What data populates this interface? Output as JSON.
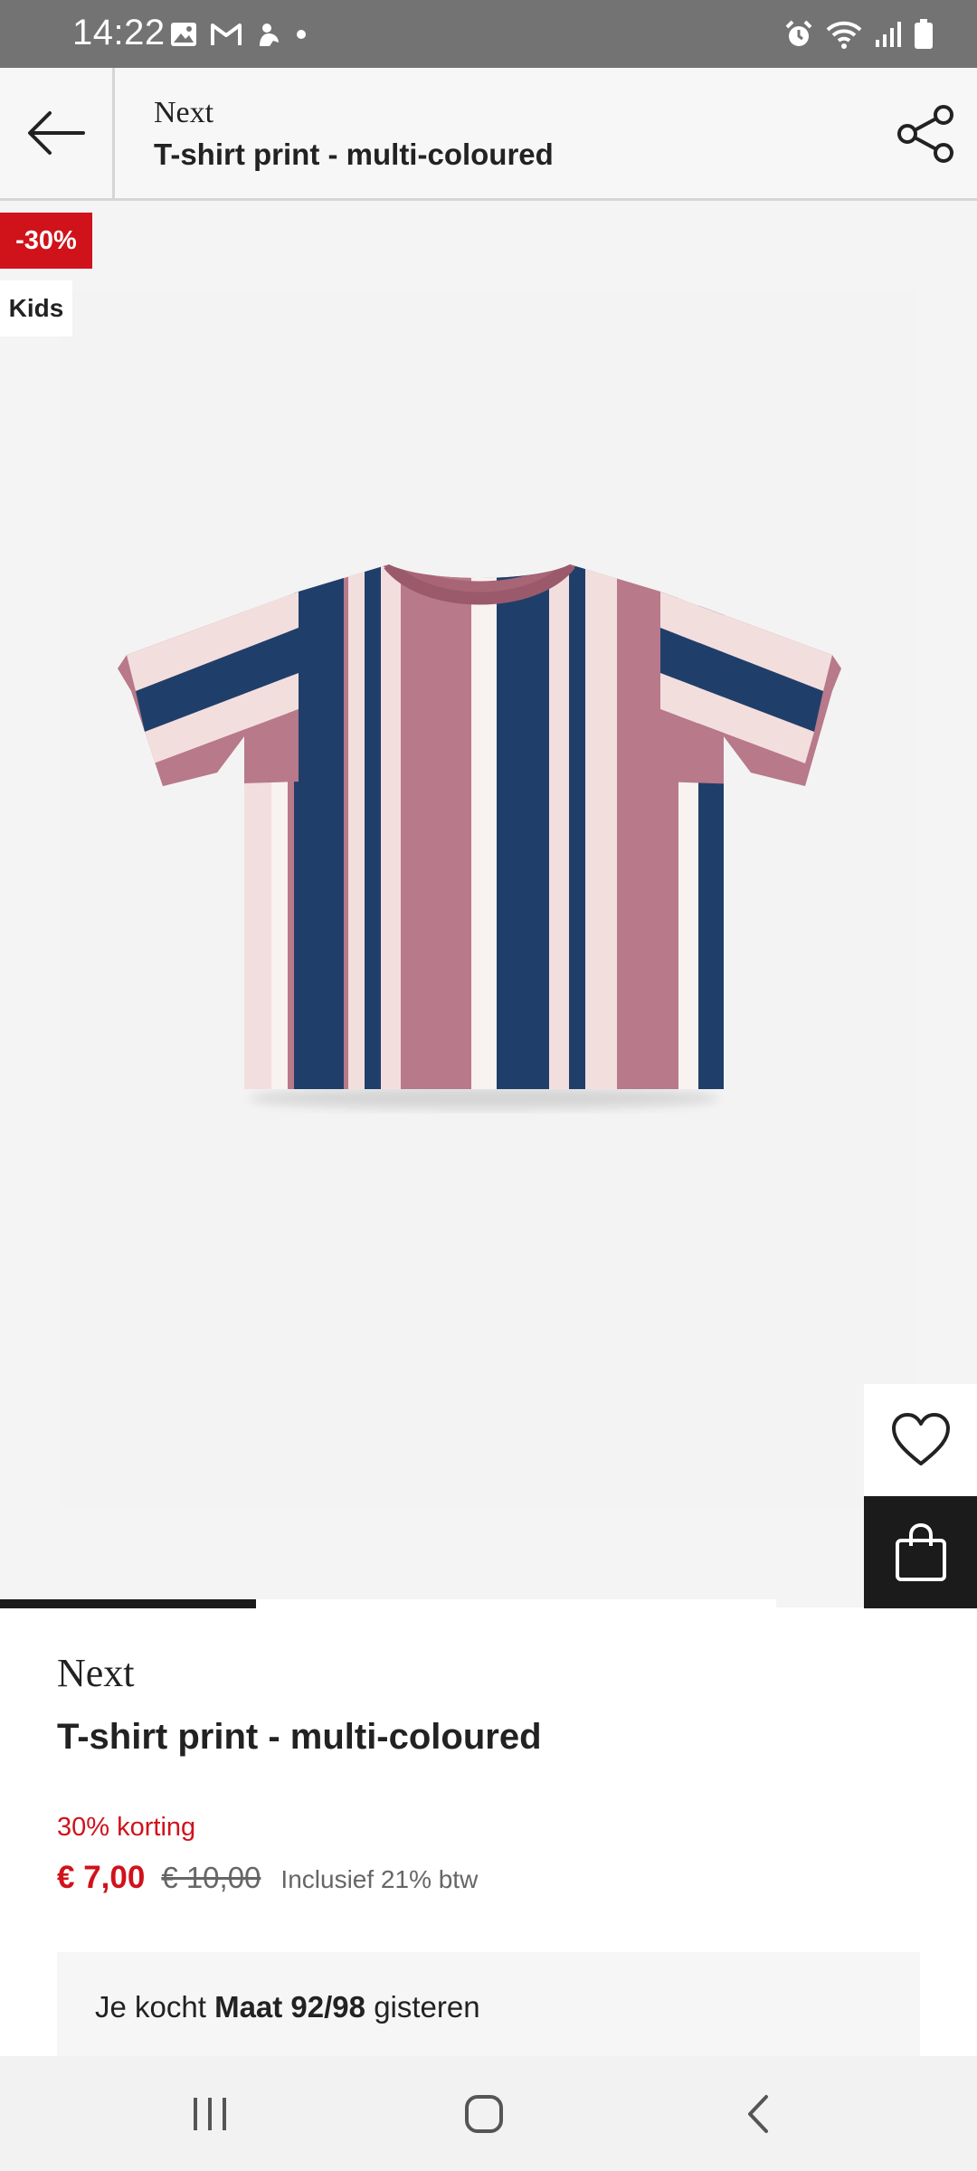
{
  "status_bar": {
    "time": "14:22",
    "left_icons": [
      "image-icon",
      "gmail-icon",
      "app-notification-icon",
      "dot-icon"
    ],
    "right_icons": [
      "alarm-icon",
      "wifi-icon",
      "signal-icon",
      "battery-icon"
    ]
  },
  "app_bar": {
    "brand": "Next",
    "product_title": "T-shirt print - multi-coloured",
    "back_icon": "arrow-left-icon",
    "share_icon": "share-icon"
  },
  "badges": {
    "discount": "-30%",
    "category": "Kids"
  },
  "image": {
    "alt": "T-shirt print - multi-coloured",
    "carousel_progress": 0.33,
    "stripe_colors": [
      "#b8798a",
      "#1f3f6a",
      "#f3dede"
    ]
  },
  "actions": {
    "wishlist_icon": "heart-icon",
    "cart_icon": "shopping-bag-icon"
  },
  "product": {
    "brand": "Next",
    "title": "T-shirt print - multi-coloured",
    "discount_label": "30% korting",
    "price_now": "€ 7,00",
    "price_was": "€ 10,00",
    "vat_note": "Inclusief 21% btw"
  },
  "purchase_history": {
    "prefix": "Je kocht",
    "size": "Maat 92/98",
    "suffix": "gisteren"
  },
  "nav_bar": {
    "icons": [
      "recent-apps-icon",
      "home-icon",
      "back-icon"
    ]
  },
  "colors": {
    "accent_red": "#d0121b",
    "dark": "#1b1b1b",
    "status_bar_bg": "#737373"
  }
}
